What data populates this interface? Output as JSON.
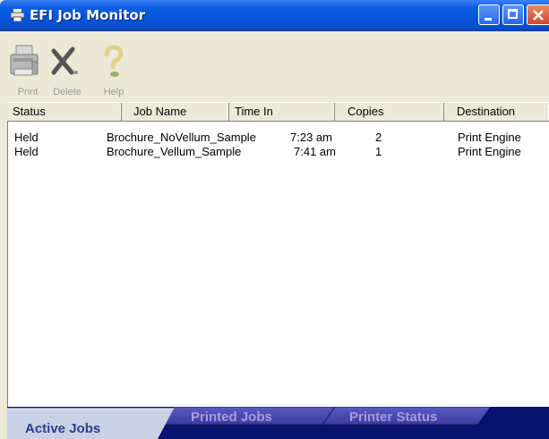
{
  "window": {
    "title": "EFI Job Monitor"
  },
  "toolbar": {
    "print_label": "Print",
    "delete_label": "Delete",
    "help_label": "Help"
  },
  "columns": [
    "Status",
    "Job Name",
    "Time In",
    "Copies",
    "Destination"
  ],
  "jobs": [
    {
      "status": "Held",
      "job_name": "Brochure_NoVellum_Sample",
      "time_in": "7:23 am",
      "copies": "2",
      "destination": "Print Engine"
    },
    {
      "status": "Held",
      "job_name": "Brochure_Vellum_Sample",
      "time_in": "7:41 am",
      "copies": "1",
      "destination": "Print Engine"
    }
  ],
  "tabs": [
    {
      "label": "Active Jobs",
      "active": true
    },
    {
      "label": "Printed Jobs",
      "active": false
    },
    {
      "label": "Printer Status",
      "active": false
    }
  ],
  "icons": {
    "app": "printer-icon",
    "print": "printer-icon",
    "delete": "delete-x-icon",
    "help": "question-mark-icon"
  },
  "colors": {
    "titlebar": "#0553d8",
    "tab_bar": "#07126e",
    "active_tab_text": "#2b3c97",
    "inactive_tab_text": "#a99adf"
  }
}
